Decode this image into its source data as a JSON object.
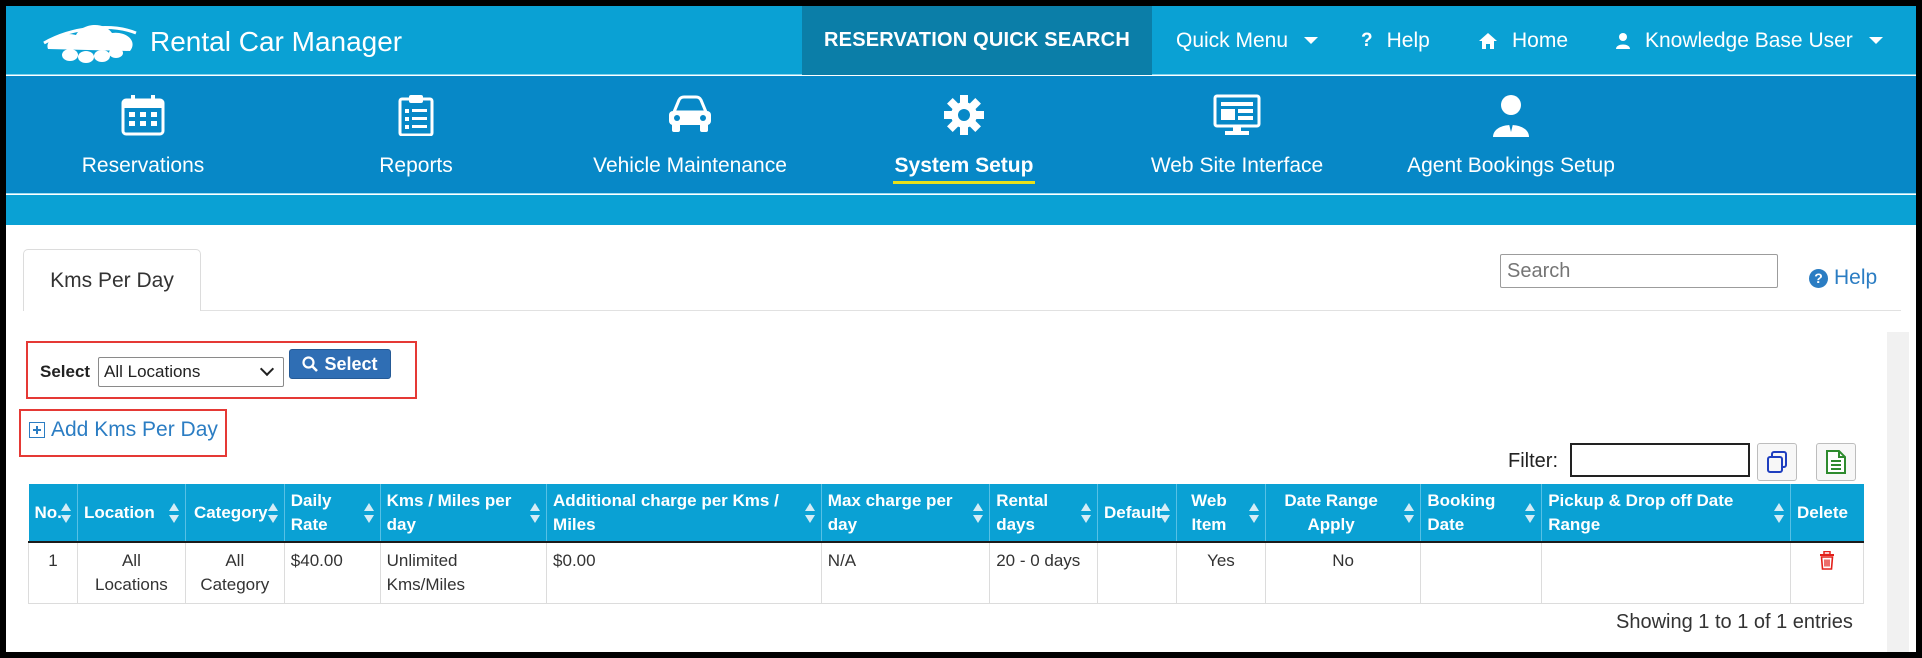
{
  "topbar": {
    "app_title": "Rental Car Manager",
    "quick_search": "RESERVATION QUICK SEARCH",
    "quick_menu": "Quick Menu",
    "help": "Help",
    "home": "Home",
    "user": "Knowledge Base User"
  },
  "mainnav": {
    "items": [
      {
        "label": "Reservations",
        "icon": "calendar-icon"
      },
      {
        "label": "Reports",
        "icon": "clipboard-icon"
      },
      {
        "label": "Vehicle Maintenance",
        "icon": "car-icon"
      },
      {
        "label": "System Setup",
        "icon": "gear-icon",
        "active": true
      },
      {
        "label": "Web Site Interface",
        "icon": "monitor-icon"
      },
      {
        "label": "Agent Bookings Setup",
        "icon": "agent-icon"
      }
    ]
  },
  "page": {
    "tab_label": "Kms Per Day",
    "search_placeholder": "Search",
    "help_label": "Help"
  },
  "toolbar": {
    "select_label": "Select",
    "location_value": "All Locations",
    "select_button": "Select",
    "add_link": "Add Kms Per Day",
    "filter_label": "Filter:"
  },
  "table": {
    "headers": [
      "No.",
      "Location",
      "Category",
      "Daily Rate",
      "Kms / Miles per day",
      "Additional charge per Kms / Miles",
      "Max charge per day",
      "Rental days",
      "Default",
      "Web Item",
      "Date Range Apply",
      "Booking Date",
      "Pickup & Drop off Date Range",
      "Delete"
    ],
    "rows": [
      {
        "no": "1",
        "location": "All Locations",
        "category": "All Category",
        "daily_rate": "$40.00",
        "kms": "Unlimited Kms/Miles",
        "additional_charge": "$0.00",
        "max_charge": "N/A",
        "rental_days": "20 - 0 days",
        "default": "",
        "web_item": "Yes",
        "date_range_apply": "No",
        "booking_date": "",
        "pickup_dropoff": ""
      }
    ],
    "footer": "Showing 1 to 1 of 1 entries"
  },
  "colors": {
    "topbar": "#0aa1d4",
    "quick_search_bg": "#0b7ea8",
    "mainnav": "#0788c7",
    "active_underline": "#e8e01a",
    "link": "#2b7dc3",
    "highlight_outline": "#e53935",
    "rate_text": "#e3211b"
  }
}
